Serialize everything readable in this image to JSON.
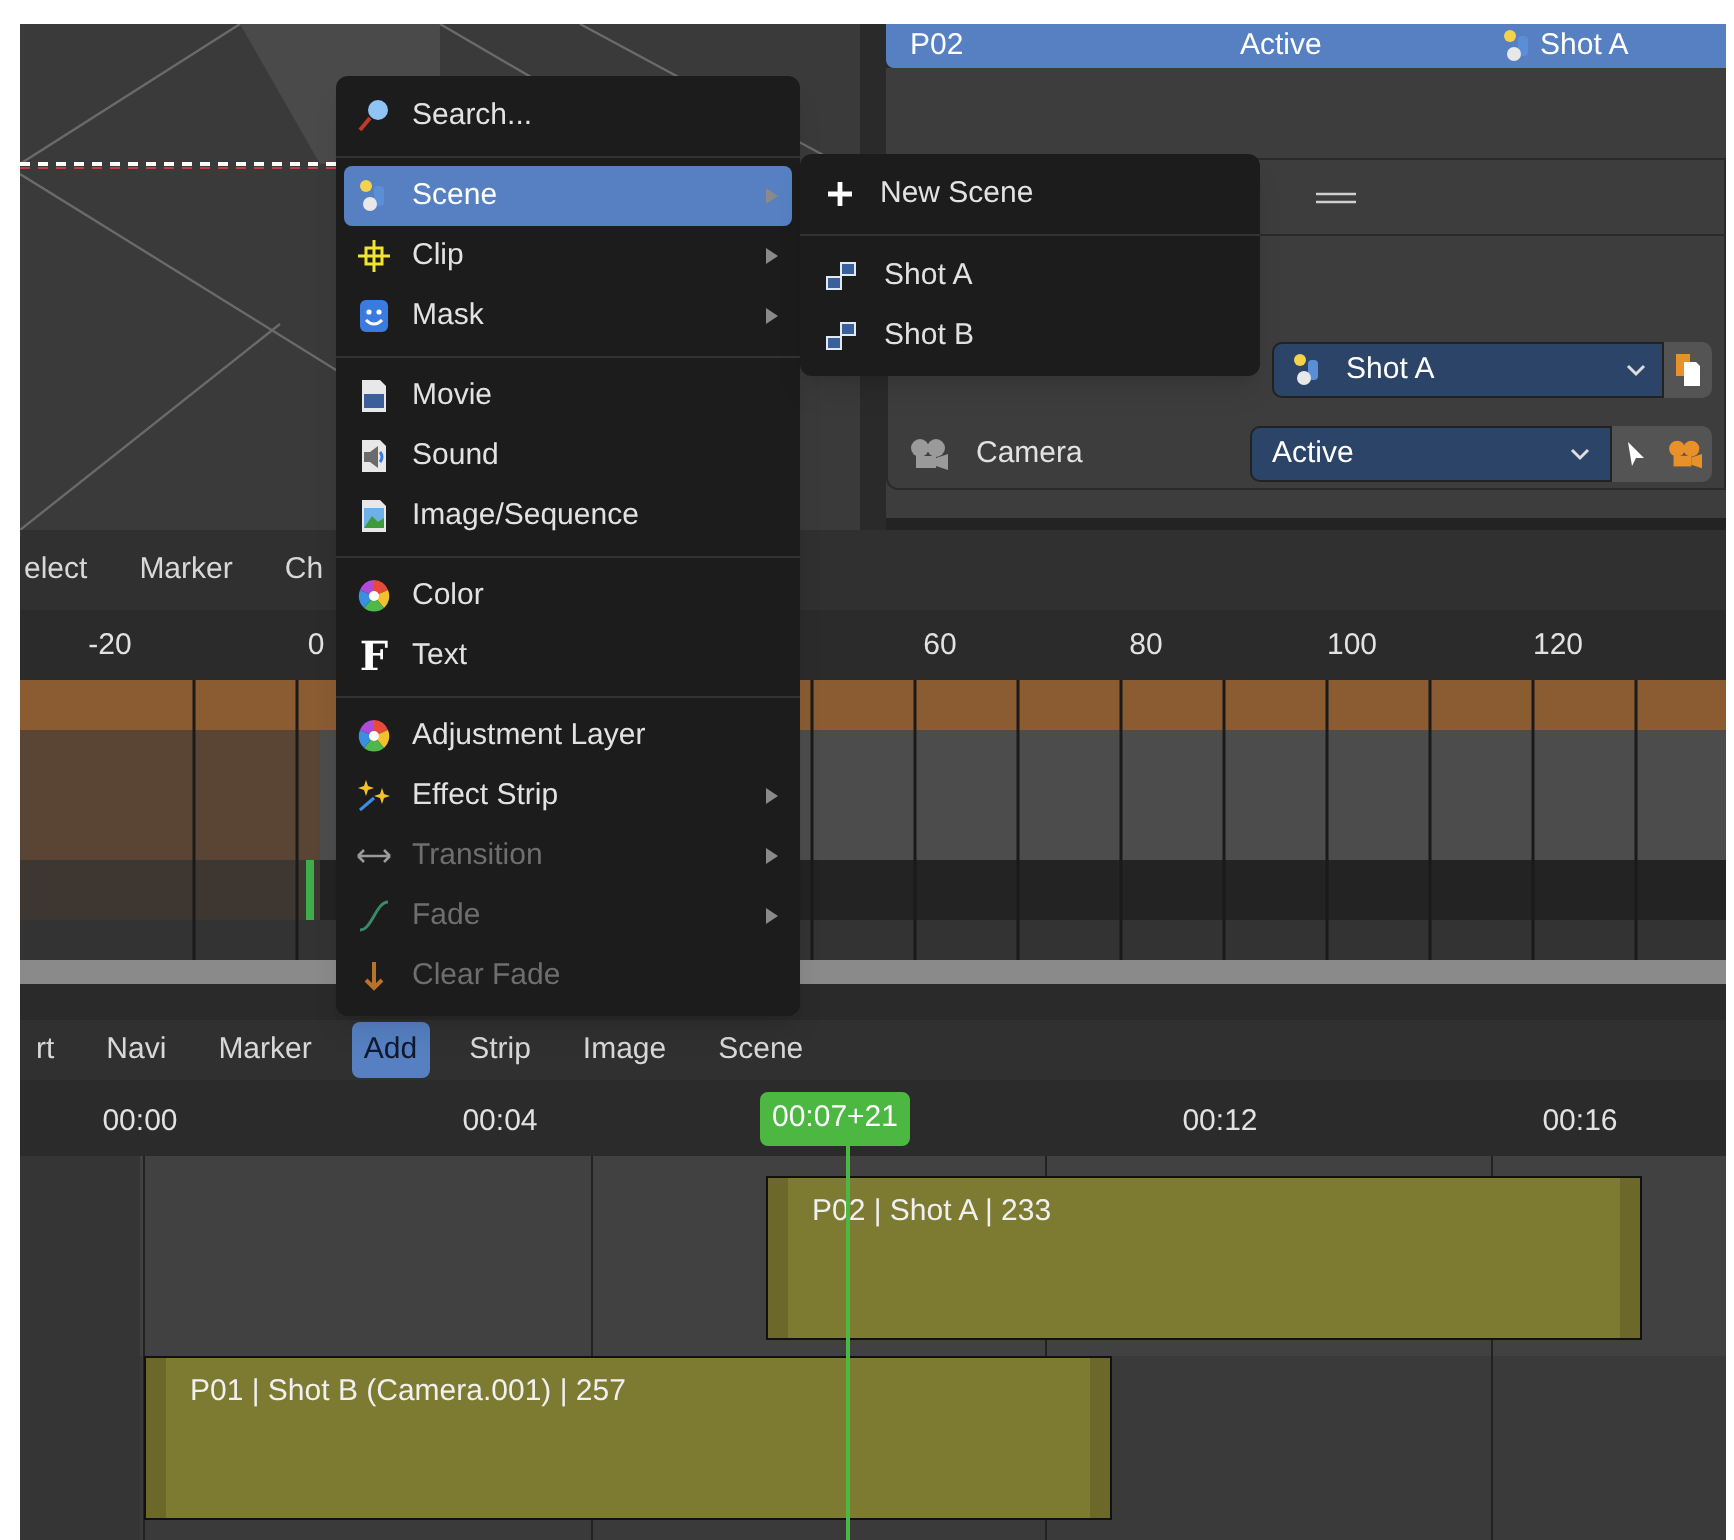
{
  "properties": {
    "active_row": {
      "name": "P02",
      "camera": "Active",
      "scene": "Shot A"
    },
    "scene_field": {
      "value": "Shot A"
    },
    "camera_row": {
      "label": "Camera",
      "value": "Active"
    }
  },
  "dopesheet": {
    "menu": [
      {
        "label": "elect",
        "selected": false
      },
      {
        "label": "Marker",
        "selected": false
      },
      {
        "label": "Ch",
        "selected": false
      }
    ],
    "ruler": [
      "-20",
      "0",
      "60",
      "80",
      "100",
      "120"
    ]
  },
  "sequencer": {
    "menu": [
      {
        "label": "rt",
        "selected": false
      },
      {
        "label": "Navi",
        "selected": false
      },
      {
        "label": "Marker",
        "selected": false
      },
      {
        "label": "Add",
        "selected": true
      },
      {
        "label": "Strip",
        "selected": false
      },
      {
        "label": "Image",
        "selected": false
      },
      {
        "label": "Scene",
        "selected": false
      }
    ],
    "ruler": [
      "00:00",
      "00:04",
      "00:12",
      "00:16"
    ],
    "playhead": "00:07+21",
    "strips": [
      {
        "label": "P02 | Shot A | 233"
      },
      {
        "label": "P01 | Shot B (Camera.001) | 257"
      }
    ]
  },
  "add_menu": {
    "groups": [
      [
        {
          "label": "Search...",
          "selected": false,
          "submenu": false,
          "disabled": false
        }
      ],
      [
        {
          "label": "Scene",
          "selected": true,
          "submenu": true,
          "disabled": false
        },
        {
          "label": "Clip",
          "selected": false,
          "submenu": true,
          "disabled": false
        },
        {
          "label": "Mask",
          "selected": false,
          "submenu": true,
          "disabled": false
        }
      ],
      [
        {
          "label": "Movie",
          "selected": false,
          "submenu": false,
          "disabled": false
        },
        {
          "label": "Sound",
          "selected": false,
          "submenu": false,
          "disabled": false
        },
        {
          "label": "Image/Sequence",
          "selected": false,
          "submenu": false,
          "disabled": false
        }
      ],
      [
        {
          "label": "Color",
          "selected": false,
          "submenu": false,
          "disabled": false
        },
        {
          "label": "Text",
          "icon_text": "F",
          "selected": false,
          "submenu": false,
          "disabled": false
        }
      ],
      [
        {
          "label": "Adjustment Layer",
          "selected": false,
          "submenu": false,
          "disabled": false
        },
        {
          "label": "Effect Strip",
          "selected": false,
          "submenu": true,
          "disabled": false
        },
        {
          "label": "Transition",
          "selected": false,
          "submenu": true,
          "disabled": true
        },
        {
          "label": "Fade",
          "selected": false,
          "submenu": true,
          "disabled": true
        },
        {
          "label": "Clear Fade",
          "selected": false,
          "submenu": false,
          "disabled": true
        }
      ]
    ]
  },
  "scene_submenu": {
    "groups": [
      [
        {
          "label": "New Scene",
          "selected": false
        }
      ],
      [
        {
          "label": "Shot A",
          "selected": false
        },
        {
          "label": "Shot B",
          "selected": false
        }
      ]
    ]
  }
}
